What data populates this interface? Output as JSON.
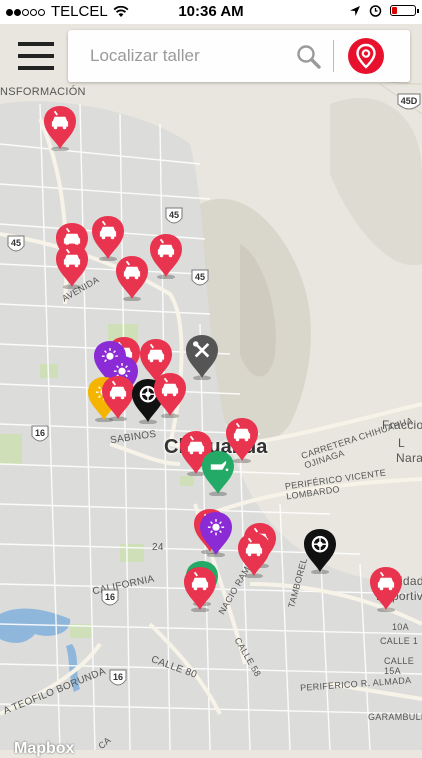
{
  "status_bar": {
    "carrier": "TELCEL",
    "time": "10:36 AM",
    "signal_bars": 2
  },
  "search": {
    "placeholder": "Localizar taller"
  },
  "map": {
    "city_label": "Chihuahua",
    "attribution": "Mapbox",
    "street_labels": [
      "NSFORMACIÓN",
      "AVENIDA",
      "SABINOS",
      "CARRETERA CHIHUAHUA OJINAGA",
      "Fraccio",
      "L",
      "Nara",
      "PERIFÉRICO VICENTE LOMBARDO",
      "24",
      "CALIFORNIA",
      "NACIO RAMIREZ",
      "TAMBOREL",
      "Unidad",
      "Deportiva",
      "10A",
      "CALLE 1",
      "CALLE 15A",
      "PERIFERICO R. ALMADA",
      "CALLE 80",
      "CALLE 58",
      "A TEOFILO BORUNDA",
      "GARAMBULLO",
      "CA"
    ],
    "shields": [
      "45D",
      "45",
      "45",
      "45",
      "16",
      "16",
      "16"
    ]
  },
  "colors": {
    "red": "#e8344e",
    "purple": "#8a2bd6",
    "yellow": "#f4b400",
    "green": "#22aa66",
    "black": "#111111",
    "gray": "#555555",
    "accent": "#e8112d"
  },
  "icons": {
    "menu": "hamburger-menu-icon",
    "search": "search-icon",
    "location": "location-pin-icon",
    "workshop": "car-repair-icon",
    "tire": "tire-icon",
    "tools": "wrench-screwdriver-icon",
    "paint": "paint-gun-icon",
    "lube": "oil-can-icon"
  }
}
